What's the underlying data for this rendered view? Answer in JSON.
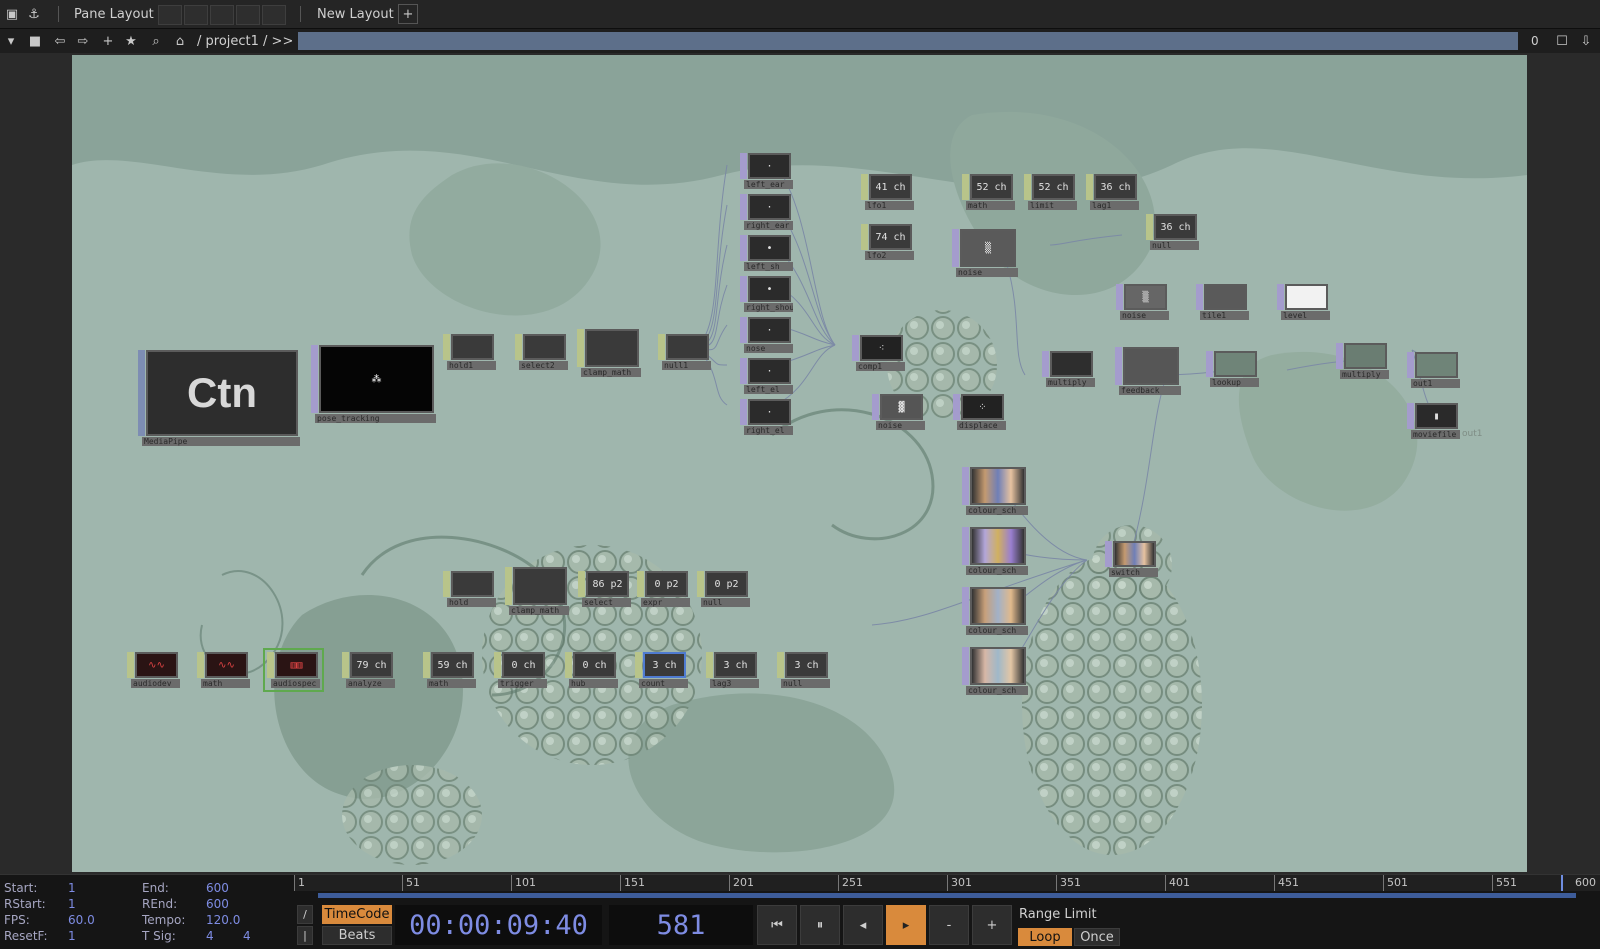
{
  "topbar": {
    "pane_layout_label": "Pane Layout",
    "new_layout_label": "New Layout",
    "add_label": "+"
  },
  "pathbar": {
    "path": "/ project1 / >>",
    "right_value": "0"
  },
  "nodes": {
    "ctn_text": "Ctn",
    "mediapipe": "MediaPipe",
    "pose_tracking": "pose_tracking",
    "hold1": "hold1",
    "select2": "select2",
    "clamp_math": "clamp_math",
    "null1": "null1",
    "left_ear": "left_ear",
    "right_ear": "right_ear",
    "left_sh": "left_sh",
    "right_sh": "right_shoulder",
    "nose": "nose",
    "left_el": "left_el",
    "right_el": "right_el",
    "comp1": "comp1",
    "noise_top": "noise",
    "displace": "displace",
    "lfo1_val": "41 ch",
    "lfo1": "lfo1",
    "lfo2_val": "74 ch",
    "lfo2": "lfo2",
    "math_val": "52 ch",
    "math": "math",
    "limit_val": "52 ch",
    "limit": "limit",
    "lag1_val": "36 ch",
    "lag1": "lag1",
    "null_ch_val": "36 ch",
    "null_ch": "null",
    "noise2": "noise",
    "noise3": "noise",
    "tile1": "tile1",
    "level": "level",
    "multiply": "multiply",
    "feedback": "feedback",
    "lookup": "lookup",
    "multiply2": "multiply",
    "out1": "out1",
    "moviefile": "moviefile",
    "out1_tag": "out1",
    "colour_a": "colour_sch",
    "colour_b": "colour_sch",
    "colour_c": "colour_sch",
    "colour_d": "colour_sch",
    "switch": "switch",
    "hold2": "hold",
    "clamp_math2": "clamp_math",
    "select_val": "86 p2",
    "select": "select",
    "expr_val": "0 p2",
    "expr": "expr",
    "null2_val": "0 p2",
    "null2": "null",
    "audiodev": "audiodev",
    "math2": "math",
    "audiospec": "audiospec",
    "analyze_val": "79 ch",
    "analyze": "analyze",
    "math3_val": "59 ch",
    "math3": "math",
    "trigger_val": "0 ch",
    "trigger": "trigger",
    "hub_val": "0 ch",
    "hub": "hub",
    "count_val": "3 ch",
    "count": "count",
    "lag3_val": "3 ch",
    "lag3": "lag3",
    "null3_val": "3 ch",
    "null3": "null"
  },
  "stats": {
    "start_label": "Start:",
    "start_val": "1",
    "rstart_label": "RStart:",
    "rstart_val": "1",
    "fps_label": "FPS:",
    "fps_val": "60.0",
    "resetf_label": "ResetF:",
    "resetf_val": "1",
    "end_label": "End:",
    "end_val": "600",
    "rend_label": "REnd:",
    "rend_val": "600",
    "tempo_label": "Tempo:",
    "tempo_val": "120.0",
    "tsig_label": "T Sig:",
    "tsig_val1": "4",
    "tsig_val2": "4"
  },
  "timeline": {
    "ticks": [
      "1",
      "51",
      "101",
      "151",
      "201",
      "251",
      "301",
      "351",
      "401",
      "451",
      "501",
      "551"
    ],
    "end_label": "600"
  },
  "transport": {
    "timecode_label": "TimeCode",
    "beats_label": "Beats",
    "timecode": "00:00:09:40",
    "frame": "581",
    "minus": "-",
    "plus": "+",
    "range_limit": "Range Limit",
    "loop": "Loop",
    "once": "Once"
  },
  "colors": {
    "accent_orange": "#d98a3c",
    "time_blue": "#7e8ce3",
    "path_field": "#5d6f8a"
  }
}
